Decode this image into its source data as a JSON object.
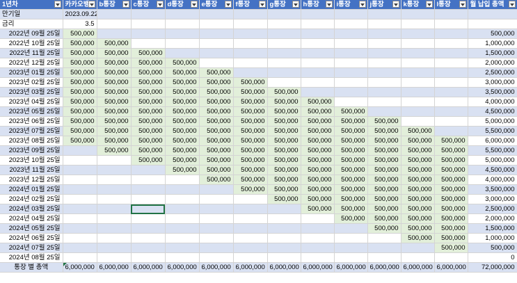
{
  "headers": [
    "1년차",
    "카카오뱅",
    "b통장",
    "c통장",
    "d통장",
    "e통장",
    "f통장",
    "g통장",
    "h통장",
    "i통장",
    "j통장",
    "k통장",
    "l통장",
    "월 납입 총액"
  ],
  "info_rows": [
    {
      "label": "만기일",
      "value": "2023.09.22"
    },
    {
      "label": "금리",
      "value": "3.5"
    }
  ],
  "rows": [
    {
      "date": "2022년 09월 25일",
      "start": 0,
      "end": 0,
      "total": "500,000"
    },
    {
      "date": "2022년 10월 25일",
      "start": 0,
      "end": 1,
      "total": "1,000,000"
    },
    {
      "date": "2022년 11월 25일",
      "start": 0,
      "end": 2,
      "total": "1,500,000"
    },
    {
      "date": "2022년 12월 25일",
      "start": 0,
      "end": 3,
      "total": "2,000,000"
    },
    {
      "date": "2023년 01월 25일",
      "start": 0,
      "end": 4,
      "total": "2,500,000"
    },
    {
      "date": "2023년 02월 25일",
      "start": 0,
      "end": 5,
      "total": "3,000,000"
    },
    {
      "date": "2023년 03월 25일",
      "start": 0,
      "end": 6,
      "total": "3,500,000"
    },
    {
      "date": "2023년 04월 25일",
      "start": 0,
      "end": 7,
      "total": "4,000,000"
    },
    {
      "date": "2023년 05월 25일",
      "start": 0,
      "end": 8,
      "total": "4,500,000"
    },
    {
      "date": "2023년 06월 25일",
      "start": 0,
      "end": 9,
      "total": "5,000,000"
    },
    {
      "date": "2023년 07월 25일",
      "start": 0,
      "end": 10,
      "total": "5,500,000"
    },
    {
      "date": "2023년 08월 25일",
      "start": 0,
      "end": 11,
      "total": "6,000,000"
    },
    {
      "date": "2023년 09월 25일",
      "start": 1,
      "end": 11,
      "total": "5,500,000"
    },
    {
      "date": "2023년 10월 25일",
      "start": 2,
      "end": 11,
      "total": "5,000,000"
    },
    {
      "date": "2023년 11월 25일",
      "start": 3,
      "end": 11,
      "total": "4,500,000"
    },
    {
      "date": "2023년 12월 25일",
      "start": 4,
      "end": 11,
      "total": "4,000,000"
    },
    {
      "date": "2024년 01월 25일",
      "start": 5,
      "end": 11,
      "total": "3,500,000"
    },
    {
      "date": "2024년 02월 25일",
      "start": 6,
      "end": 11,
      "total": "3,000,000"
    },
    {
      "date": "2024년 03월 25일",
      "start": 7,
      "end": 11,
      "total": "2,500,000"
    },
    {
      "date": "2024년 04월 25일",
      "start": 8,
      "end": 11,
      "total": "2,000,000"
    },
    {
      "date": "2024년 05월 25일",
      "start": 9,
      "end": 11,
      "total": "1,500,000"
    },
    {
      "date": "2024년 06월 25일",
      "start": 10,
      "end": 11,
      "total": "1,000,000"
    },
    {
      "date": "2024년 07월 25일",
      "start": 11,
      "end": 11,
      "total": "500,000"
    },
    {
      "date": "2024년 08월 25일",
      "start": 12,
      "end": 11,
      "total": "0"
    }
  ],
  "cell_value": "500,000",
  "totals": {
    "label": "통장 별 총액",
    "values": [
      "6,000,000",
      "6,000,000",
      "6,000,000",
      "6,000,000",
      "6,000,000",
      "6,000,000",
      "6,000,000",
      "6,000,000",
      "6,000,000",
      "6,000,000",
      "6,000,000",
      "6,000,000"
    ],
    "grand_total": "72,000,000"
  },
  "colors": {
    "header": "#4472c4",
    "band": "#d9e1f2",
    "green_fill": "#e2efda",
    "selection": "#217346"
  }
}
